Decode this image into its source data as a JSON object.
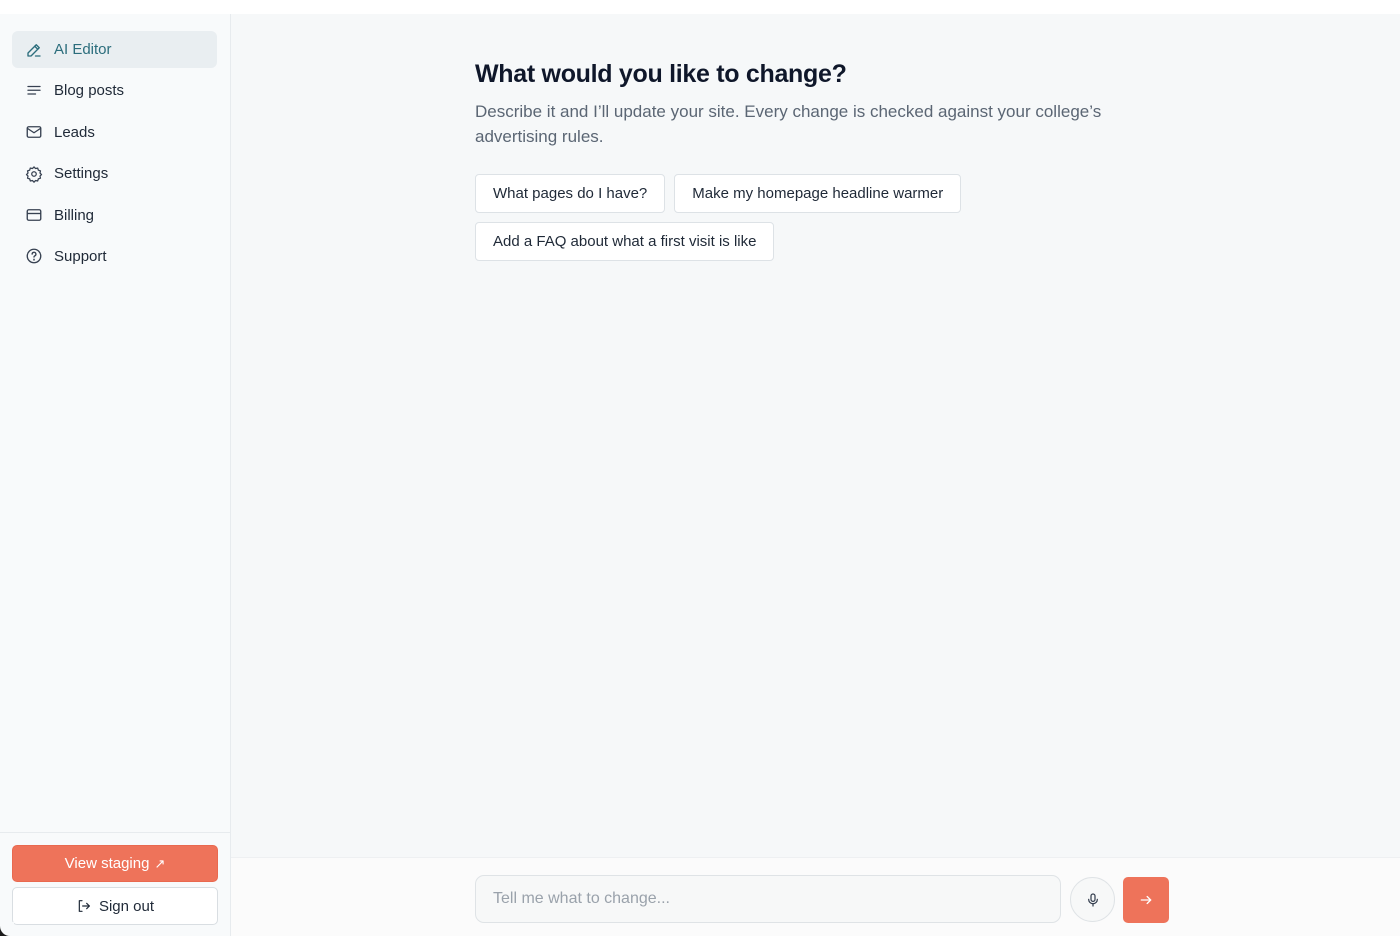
{
  "sidebar": {
    "items": [
      {
        "label": "AI Editor",
        "icon": "pencil-icon",
        "active": true
      },
      {
        "label": "Blog posts",
        "icon": "lines-icon",
        "active": false
      },
      {
        "label": "Leads",
        "icon": "mail-icon",
        "active": false
      },
      {
        "label": "Settings",
        "icon": "gear-icon",
        "active": false
      },
      {
        "label": "Billing",
        "icon": "credit-card-icon",
        "active": false
      },
      {
        "label": "Support",
        "icon": "help-circle-icon",
        "active": false
      }
    ],
    "view_staging_label": "View staging",
    "view_staging_arrow": "↗",
    "sign_out_label": "Sign out"
  },
  "main": {
    "title": "What would you like to change?",
    "subtitle": "Describe it and I’ll update your site. Every change is checked against your college’s advertising rules.",
    "suggestions": [
      "What pages do I have?",
      "Make my homepage headline warmer",
      "Add a FAQ about what a first visit is like"
    ]
  },
  "composer": {
    "placeholder": "Tell me what to change...",
    "mic_icon": "microphone-icon",
    "send_icon": "arrow-right-icon"
  },
  "colors": {
    "accent": "#ee735a",
    "active_nav_text": "#2b6d7c",
    "active_nav_bg": "#e9eef1"
  }
}
